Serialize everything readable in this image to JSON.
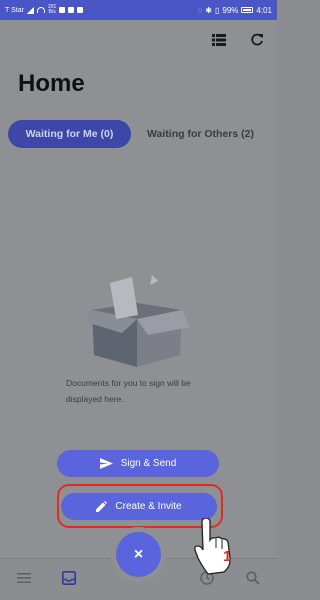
{
  "status_bar": {
    "carrier": "T Star",
    "net_speed_top": "201",
    "net_speed_bottom": "B/s",
    "battery": "99%",
    "time": "4:01"
  },
  "page": {
    "title": "Home"
  },
  "tabs": [
    {
      "label": "Waiting for Me (0)",
      "active": true
    },
    {
      "label": "Waiting for Others (2)",
      "active": false
    }
  ],
  "empty_state": {
    "message": "Documents for you to sign will be displayed here."
  },
  "actions": {
    "sign_send_label": "Sign & Send",
    "create_invite_label": "Create & Invite",
    "close_symbol": "×"
  },
  "annotation": {
    "step_number": "1"
  },
  "colors": {
    "accent": "#5a64dc",
    "status_bar": "#4a55c6",
    "highlight": "#e22b20"
  },
  "icons": [
    "list-view-icon",
    "refresh-icon",
    "send-icon",
    "pencil-icon",
    "close-icon",
    "menu-icon",
    "inbox-icon",
    "history-icon",
    "search-icon",
    "pointing-hand-icon"
  ]
}
